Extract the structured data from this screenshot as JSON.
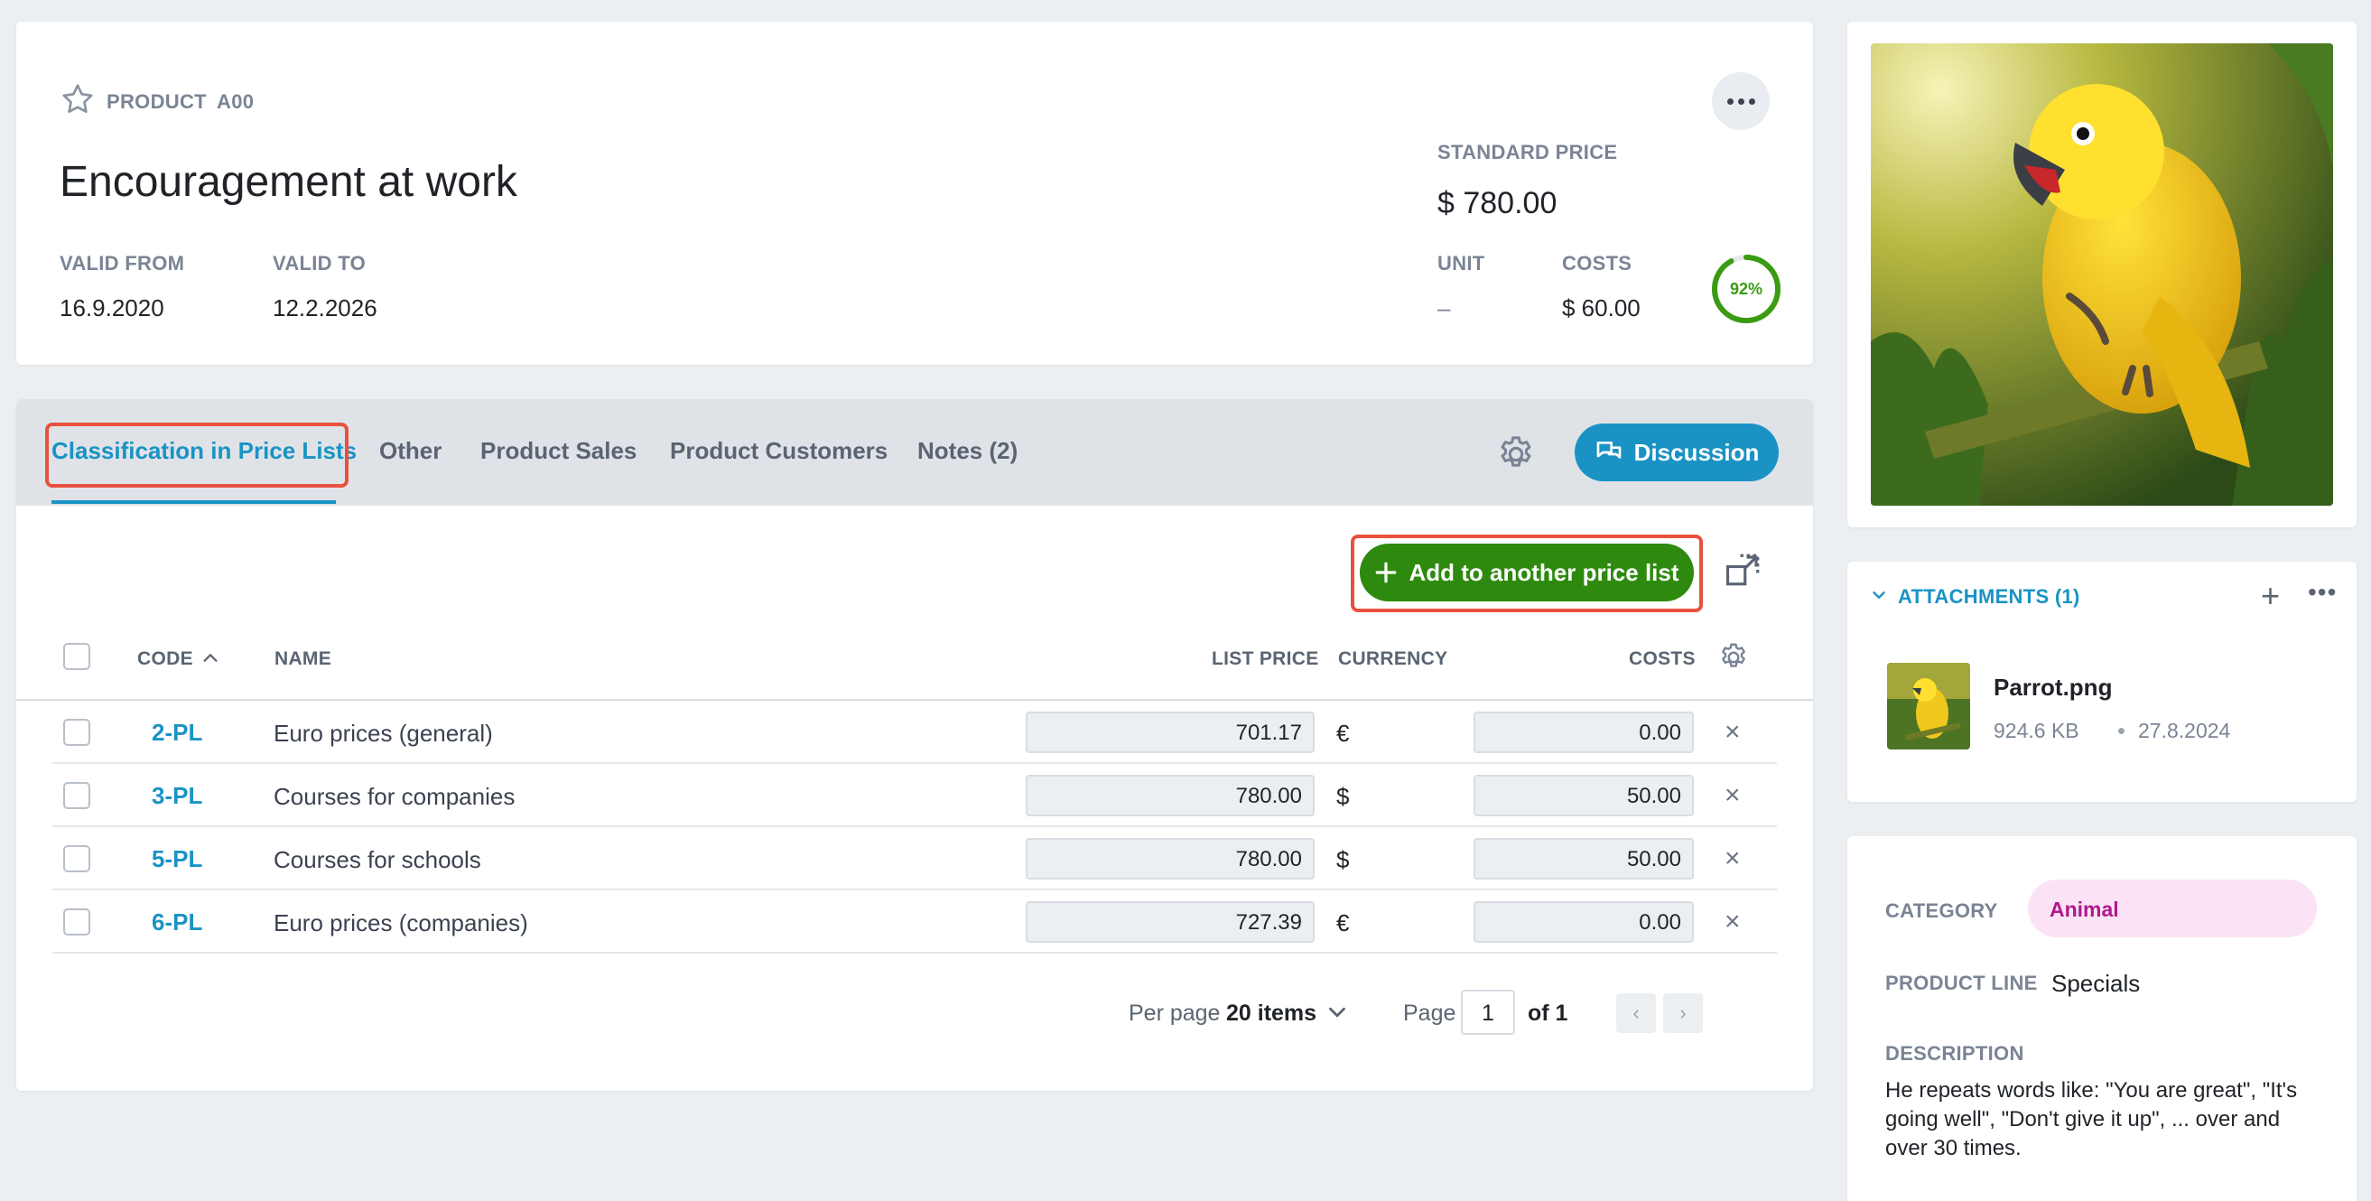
{
  "header": {
    "type_label": "PRODUCT",
    "code": "A00",
    "title": "Encouragement at work",
    "valid_from_label": "VALID FROM",
    "valid_from": "16.9.2020",
    "valid_to_label": "VALID TO",
    "valid_to": "12.2.2026",
    "standard_price_label": "STANDARD PRICE",
    "standard_price": "$ 780.00",
    "unit_label": "UNIT",
    "unit": "–",
    "costs_label": "COSTS",
    "costs": "$ 60.00",
    "margin_percent_text": "92%",
    "margin_fraction": 0.92
  },
  "tabs": [
    {
      "label": "Classification in Price Lists",
      "active": true
    },
    {
      "label": "Other",
      "active": false
    },
    {
      "label": "Product Sales",
      "active": false
    },
    {
      "label": "Product Customers",
      "active": false
    },
    {
      "label": "Notes (2)",
      "active": false
    }
  ],
  "discussion_label": "Discussion",
  "add_button_label": "Add to another price list",
  "table": {
    "headers": {
      "code": "CODE",
      "name": "NAME",
      "list_price": "LIST PRICE",
      "currency": "CURRENCY",
      "costs": "COSTS"
    },
    "rows": [
      {
        "code": "2-PL",
        "name": "Euro prices (general)",
        "list_price": "701.17",
        "currency": "€",
        "costs": "0.00"
      },
      {
        "code": "3-PL",
        "name": "Courses for companies",
        "list_price": "780.00",
        "currency": "$",
        "costs": "50.00"
      },
      {
        "code": "5-PL",
        "name": "Courses for schools",
        "list_price": "780.00",
        "currency": "$",
        "costs": "50.00"
      },
      {
        "code": "6-PL",
        "name": "Euro prices (companies)",
        "list_price": "727.39",
        "currency": "€",
        "costs": "0.00"
      }
    ]
  },
  "pager": {
    "per_page_label": "Per page",
    "per_page_value": "20 items",
    "page_label": "Page",
    "page_value": "1",
    "of_text": "of 1"
  },
  "attachments": {
    "title": "ATTACHMENTS (1)",
    "file_name": "Parrot.png",
    "file_size": "924.6 KB",
    "file_date": "27.8.2024"
  },
  "info": {
    "category_label": "CATEGORY",
    "category_value": "Animal",
    "product_line_label": "PRODUCT LINE",
    "product_line_value": "Specials",
    "description_label": "DESCRIPTION",
    "description": "He repeats words like: \"You are great\", \"It's going well\", \"Don't give it up\", ... over and over 30 times."
  },
  "colors": {
    "accent": "#1a93c4",
    "primary_action": "#2e8a0e",
    "highlight_outline": "#e8513e",
    "category_badge_bg": "#fbe3f5",
    "category_badge_text": "#b0188c",
    "progress_ring": "#3a9b12"
  }
}
